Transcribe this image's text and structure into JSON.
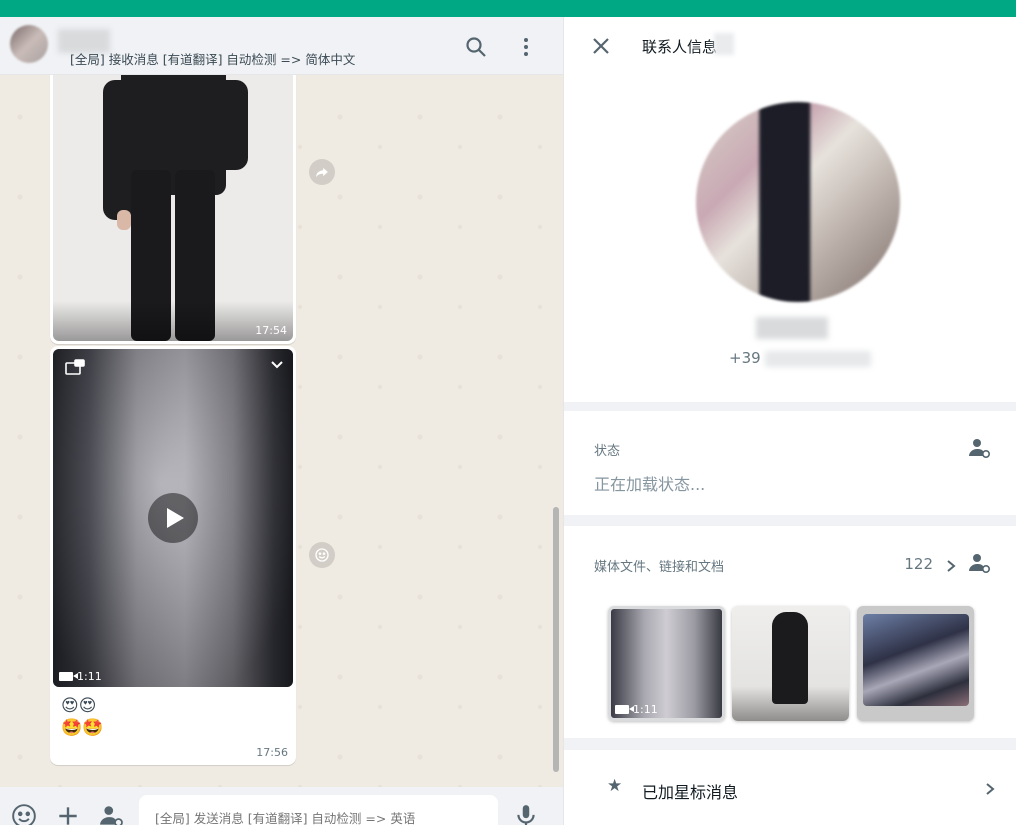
{
  "chat": {
    "header_subtitle": "[全局] 接收消息 [有道翻译] 自动检测 => 简体中文",
    "messages": [
      {
        "type": "image",
        "time": "17:54"
      },
      {
        "type": "video",
        "duration": "1:11",
        "emoji_line1": "😍😍",
        "emoji_line2": "🤩🤩",
        "time": "17:56"
      }
    ],
    "footer": {
      "input_placeholder": "[全局] 发送消息 [有道翻译] 自动检测 => 英语"
    }
  },
  "contact_info": {
    "title": "联系人信息",
    "phone_prefix": "+39",
    "status_label": "状态",
    "status_text": "正在加载状态...",
    "media_label": "媒体文件、链接和文档",
    "media_count": "122",
    "media_thumbs": [
      {
        "kind": "video",
        "duration": "1:11"
      },
      {
        "kind": "image"
      },
      {
        "kind": "image"
      }
    ],
    "starred_label": "已加星标消息"
  },
  "colors": {
    "accent": "#00a884",
    "chat_bg": "#efeae2",
    "panel_bg": "#f0f2f5"
  }
}
